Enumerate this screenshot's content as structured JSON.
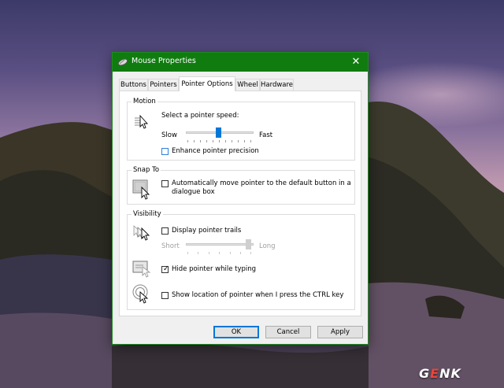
{
  "window": {
    "title": "Mouse Properties",
    "close_glyph": "✕",
    "title_icon": "mouse-icon"
  },
  "tabs": [
    {
      "label": "Buttons",
      "active": false
    },
    {
      "label": "Pointers",
      "active": false
    },
    {
      "label": "Pointer Options",
      "active": true
    },
    {
      "label": "Wheel",
      "active": false
    },
    {
      "label": "Hardware",
      "active": false
    }
  ],
  "motion": {
    "group_label": "Motion",
    "speed_label": "Select a pointer speed:",
    "slow_label": "Slow",
    "fast_label": "Fast",
    "speed_value": 0.5,
    "enhance_label": "Enhance pointer precision",
    "enhance_checked": false
  },
  "snap_to": {
    "group_label": "Snap To",
    "auto_move_label_line1": "Automatically move pointer to the default button in a",
    "auto_move_label_line2": "dialogue box",
    "auto_move_checked": false
  },
  "visibility": {
    "group_label": "Visibility",
    "trails_label": "Display pointer trails",
    "trails_checked": false,
    "short_label": "Short",
    "long_label": "Long",
    "trail_length_value": 1.0,
    "hide_label": "Hide pointer while typing",
    "hide_checked": true,
    "show_location_label": "Show location of pointer when I press the CTRL key",
    "show_location_checked": false,
    "check_glyph": "✓"
  },
  "buttons": {
    "ok": "OK",
    "cancel": "Cancel",
    "apply": "Apply"
  },
  "watermark": {
    "part1": "G",
    "part2": "E",
    "part3": "NK"
  },
  "colors": {
    "titlebar": "#107c10",
    "accent": "#0078d7"
  }
}
